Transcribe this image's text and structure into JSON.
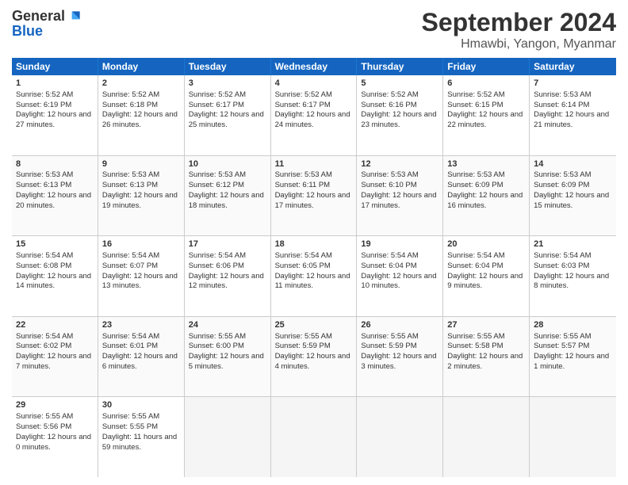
{
  "logo": {
    "general": "General",
    "blue": "Blue"
  },
  "header": {
    "month": "September 2024",
    "location": "Hmawbi, Yangon, Myanmar"
  },
  "days": [
    "Sunday",
    "Monday",
    "Tuesday",
    "Wednesday",
    "Thursday",
    "Friday",
    "Saturday"
  ],
  "weeks": [
    [
      {
        "day": "1",
        "sunrise": "Sunrise: 5:52 AM",
        "sunset": "Sunset: 6:19 PM",
        "daylight": "Daylight: 12 hours and 27 minutes."
      },
      {
        "day": "2",
        "sunrise": "Sunrise: 5:52 AM",
        "sunset": "Sunset: 6:18 PM",
        "daylight": "Daylight: 12 hours and 26 minutes."
      },
      {
        "day": "3",
        "sunrise": "Sunrise: 5:52 AM",
        "sunset": "Sunset: 6:17 PM",
        "daylight": "Daylight: 12 hours and 25 minutes."
      },
      {
        "day": "4",
        "sunrise": "Sunrise: 5:52 AM",
        "sunset": "Sunset: 6:17 PM",
        "daylight": "Daylight: 12 hours and 24 minutes."
      },
      {
        "day": "5",
        "sunrise": "Sunrise: 5:52 AM",
        "sunset": "Sunset: 6:16 PM",
        "daylight": "Daylight: 12 hours and 23 minutes."
      },
      {
        "day": "6",
        "sunrise": "Sunrise: 5:52 AM",
        "sunset": "Sunset: 6:15 PM",
        "daylight": "Daylight: 12 hours and 22 minutes."
      },
      {
        "day": "7",
        "sunrise": "Sunrise: 5:53 AM",
        "sunset": "Sunset: 6:14 PM",
        "daylight": "Daylight: 12 hours and 21 minutes."
      }
    ],
    [
      {
        "day": "8",
        "sunrise": "Sunrise: 5:53 AM",
        "sunset": "Sunset: 6:13 PM",
        "daylight": "Daylight: 12 hours and 20 minutes."
      },
      {
        "day": "9",
        "sunrise": "Sunrise: 5:53 AM",
        "sunset": "Sunset: 6:13 PM",
        "daylight": "Daylight: 12 hours and 19 minutes."
      },
      {
        "day": "10",
        "sunrise": "Sunrise: 5:53 AM",
        "sunset": "Sunset: 6:12 PM",
        "daylight": "Daylight: 12 hours and 18 minutes."
      },
      {
        "day": "11",
        "sunrise": "Sunrise: 5:53 AM",
        "sunset": "Sunset: 6:11 PM",
        "daylight": "Daylight: 12 hours and 17 minutes."
      },
      {
        "day": "12",
        "sunrise": "Sunrise: 5:53 AM",
        "sunset": "Sunset: 6:10 PM",
        "daylight": "Daylight: 12 hours and 17 minutes."
      },
      {
        "day": "13",
        "sunrise": "Sunrise: 5:53 AM",
        "sunset": "Sunset: 6:09 PM",
        "daylight": "Daylight: 12 hours and 16 minutes."
      },
      {
        "day": "14",
        "sunrise": "Sunrise: 5:53 AM",
        "sunset": "Sunset: 6:09 PM",
        "daylight": "Daylight: 12 hours and 15 minutes."
      }
    ],
    [
      {
        "day": "15",
        "sunrise": "Sunrise: 5:54 AM",
        "sunset": "Sunset: 6:08 PM",
        "daylight": "Daylight: 12 hours and 14 minutes."
      },
      {
        "day": "16",
        "sunrise": "Sunrise: 5:54 AM",
        "sunset": "Sunset: 6:07 PM",
        "daylight": "Daylight: 12 hours and 13 minutes."
      },
      {
        "day": "17",
        "sunrise": "Sunrise: 5:54 AM",
        "sunset": "Sunset: 6:06 PM",
        "daylight": "Daylight: 12 hours and 12 minutes."
      },
      {
        "day": "18",
        "sunrise": "Sunrise: 5:54 AM",
        "sunset": "Sunset: 6:05 PM",
        "daylight": "Daylight: 12 hours and 11 minutes."
      },
      {
        "day": "19",
        "sunrise": "Sunrise: 5:54 AM",
        "sunset": "Sunset: 6:04 PM",
        "daylight": "Daylight: 12 hours and 10 minutes."
      },
      {
        "day": "20",
        "sunrise": "Sunrise: 5:54 AM",
        "sunset": "Sunset: 6:04 PM",
        "daylight": "Daylight: 12 hours and 9 minutes."
      },
      {
        "day": "21",
        "sunrise": "Sunrise: 5:54 AM",
        "sunset": "Sunset: 6:03 PM",
        "daylight": "Daylight: 12 hours and 8 minutes."
      }
    ],
    [
      {
        "day": "22",
        "sunrise": "Sunrise: 5:54 AM",
        "sunset": "Sunset: 6:02 PM",
        "daylight": "Daylight: 12 hours and 7 minutes."
      },
      {
        "day": "23",
        "sunrise": "Sunrise: 5:54 AM",
        "sunset": "Sunset: 6:01 PM",
        "daylight": "Daylight: 12 hours and 6 minutes."
      },
      {
        "day": "24",
        "sunrise": "Sunrise: 5:55 AM",
        "sunset": "Sunset: 6:00 PM",
        "daylight": "Daylight: 12 hours and 5 minutes."
      },
      {
        "day": "25",
        "sunrise": "Sunrise: 5:55 AM",
        "sunset": "Sunset: 5:59 PM",
        "daylight": "Daylight: 12 hours and 4 minutes."
      },
      {
        "day": "26",
        "sunrise": "Sunrise: 5:55 AM",
        "sunset": "Sunset: 5:59 PM",
        "daylight": "Daylight: 12 hours and 3 minutes."
      },
      {
        "day": "27",
        "sunrise": "Sunrise: 5:55 AM",
        "sunset": "Sunset: 5:58 PM",
        "daylight": "Daylight: 12 hours and 2 minutes."
      },
      {
        "day": "28",
        "sunrise": "Sunrise: 5:55 AM",
        "sunset": "Sunset: 5:57 PM",
        "daylight": "Daylight: 12 hours and 1 minute."
      }
    ],
    [
      {
        "day": "29",
        "sunrise": "Sunrise: 5:55 AM",
        "sunset": "Sunset: 5:56 PM",
        "daylight": "Daylight: 12 hours and 0 minutes."
      },
      {
        "day": "30",
        "sunrise": "Sunrise: 5:55 AM",
        "sunset": "Sunset: 5:55 PM",
        "daylight": "Daylight: 11 hours and 59 minutes."
      },
      {
        "day": "",
        "empty": true
      },
      {
        "day": "",
        "empty": true
      },
      {
        "day": "",
        "empty": true
      },
      {
        "day": "",
        "empty": true
      },
      {
        "day": "",
        "empty": true
      }
    ]
  ]
}
